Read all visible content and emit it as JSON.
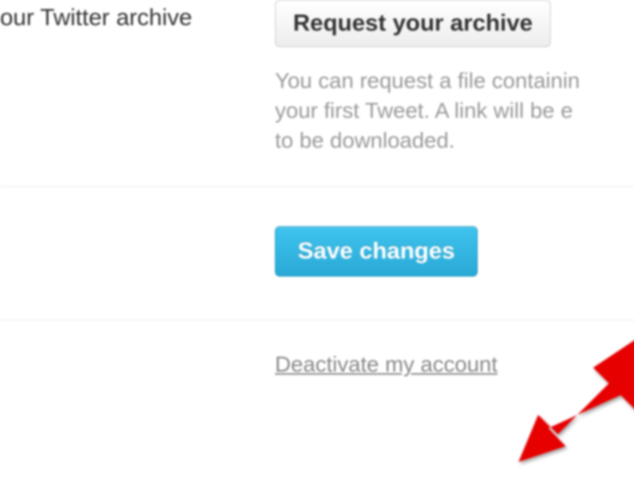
{
  "archive": {
    "label": "our Twitter archive",
    "button_label": "Request your archive",
    "help_line1": "You can request a file containin",
    "help_line2": "your first Tweet. A link will be e",
    "help_line3": "to be downloaded."
  },
  "save": {
    "button_label": "Save changes"
  },
  "deactivate": {
    "link_label": "Deactivate my account"
  }
}
